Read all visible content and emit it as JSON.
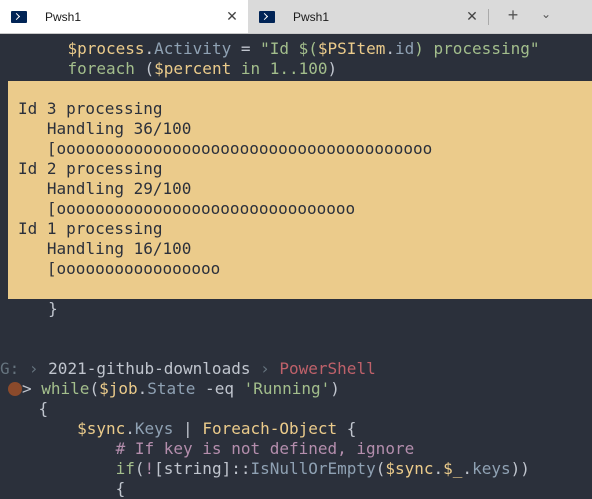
{
  "tabs": [
    {
      "label": "Pwsh1",
      "active": true,
      "close": "✕"
    },
    {
      "label": "Pwsh1",
      "active": false,
      "close": "✕"
    }
  ],
  "tabbar": {
    "new_tab": "+",
    "dropdown": "⌄"
  },
  "code_top": {
    "l1": {
      "indent": "       ",
      "var": "$process",
      "dot": ".",
      "prop": "Activity",
      "eq": " = ",
      "str": "\"Id $(",
      "var2": "$PSItem",
      "dot2": ".",
      "prop2": "id",
      "str2": ") processing\""
    },
    "l2": {
      "indent": "       ",
      "kw": "foreach",
      "p1": " (",
      "var": "$percent",
      "kw2": " in ",
      "num": "1..100",
      "p2": ")"
    }
  },
  "progress": [
    {
      "title": "Id 3 processing",
      "status": "Handling 36/100",
      "bar": "[ooooooooooooooooooooooooooooooooooooooo"
    },
    {
      "title": "Id 2 processing",
      "status": "Handling 29/100",
      "bar": "[ooooooooooooooooooooooooooooooo"
    },
    {
      "title": "Id 1 processing",
      "status": "Handling 16/100",
      "bar": "[ooooooooooooooooo"
    }
  ],
  "code_mid": {
    "brace": "     }"
  },
  "prompt": {
    "glyph": "G:",
    "sep1": " › ",
    "dir": "2021-github-downloads",
    "sep2": " › ",
    "repo": "PowerShell",
    "caret": ">"
  },
  "code_bottom": {
    "l1": {
      "kw": " while",
      "p1": "(",
      "var": "$job",
      "dot": ".",
      "prop": "State",
      "op": " -eq ",
      "str": "'Running'",
      "p2": ")"
    },
    "l2": {
      "text": "    {"
    },
    "l3": {
      "indent": "        ",
      "var": "$sync",
      "dot": ".",
      "prop": "Keys",
      "pipe": " | ",
      "fn": "Foreach-Object",
      "rest": " {"
    },
    "l4": {
      "indent": "            ",
      "cmt": "# If key is not defined, ignore"
    },
    "l5": {
      "indent": "            ",
      "kw": "if",
      "p1": "(",
      "not": "!",
      "type": "[string]",
      "colons": "::",
      "method": "IsNullOrEmpty",
      "p2": "(",
      "var": "$sync",
      "dot": ".",
      "var2": "$_",
      "dot2": ".",
      "prop": "keys",
      "p3": "))"
    },
    "l6": {
      "indent": "            ",
      "text": "{"
    }
  }
}
